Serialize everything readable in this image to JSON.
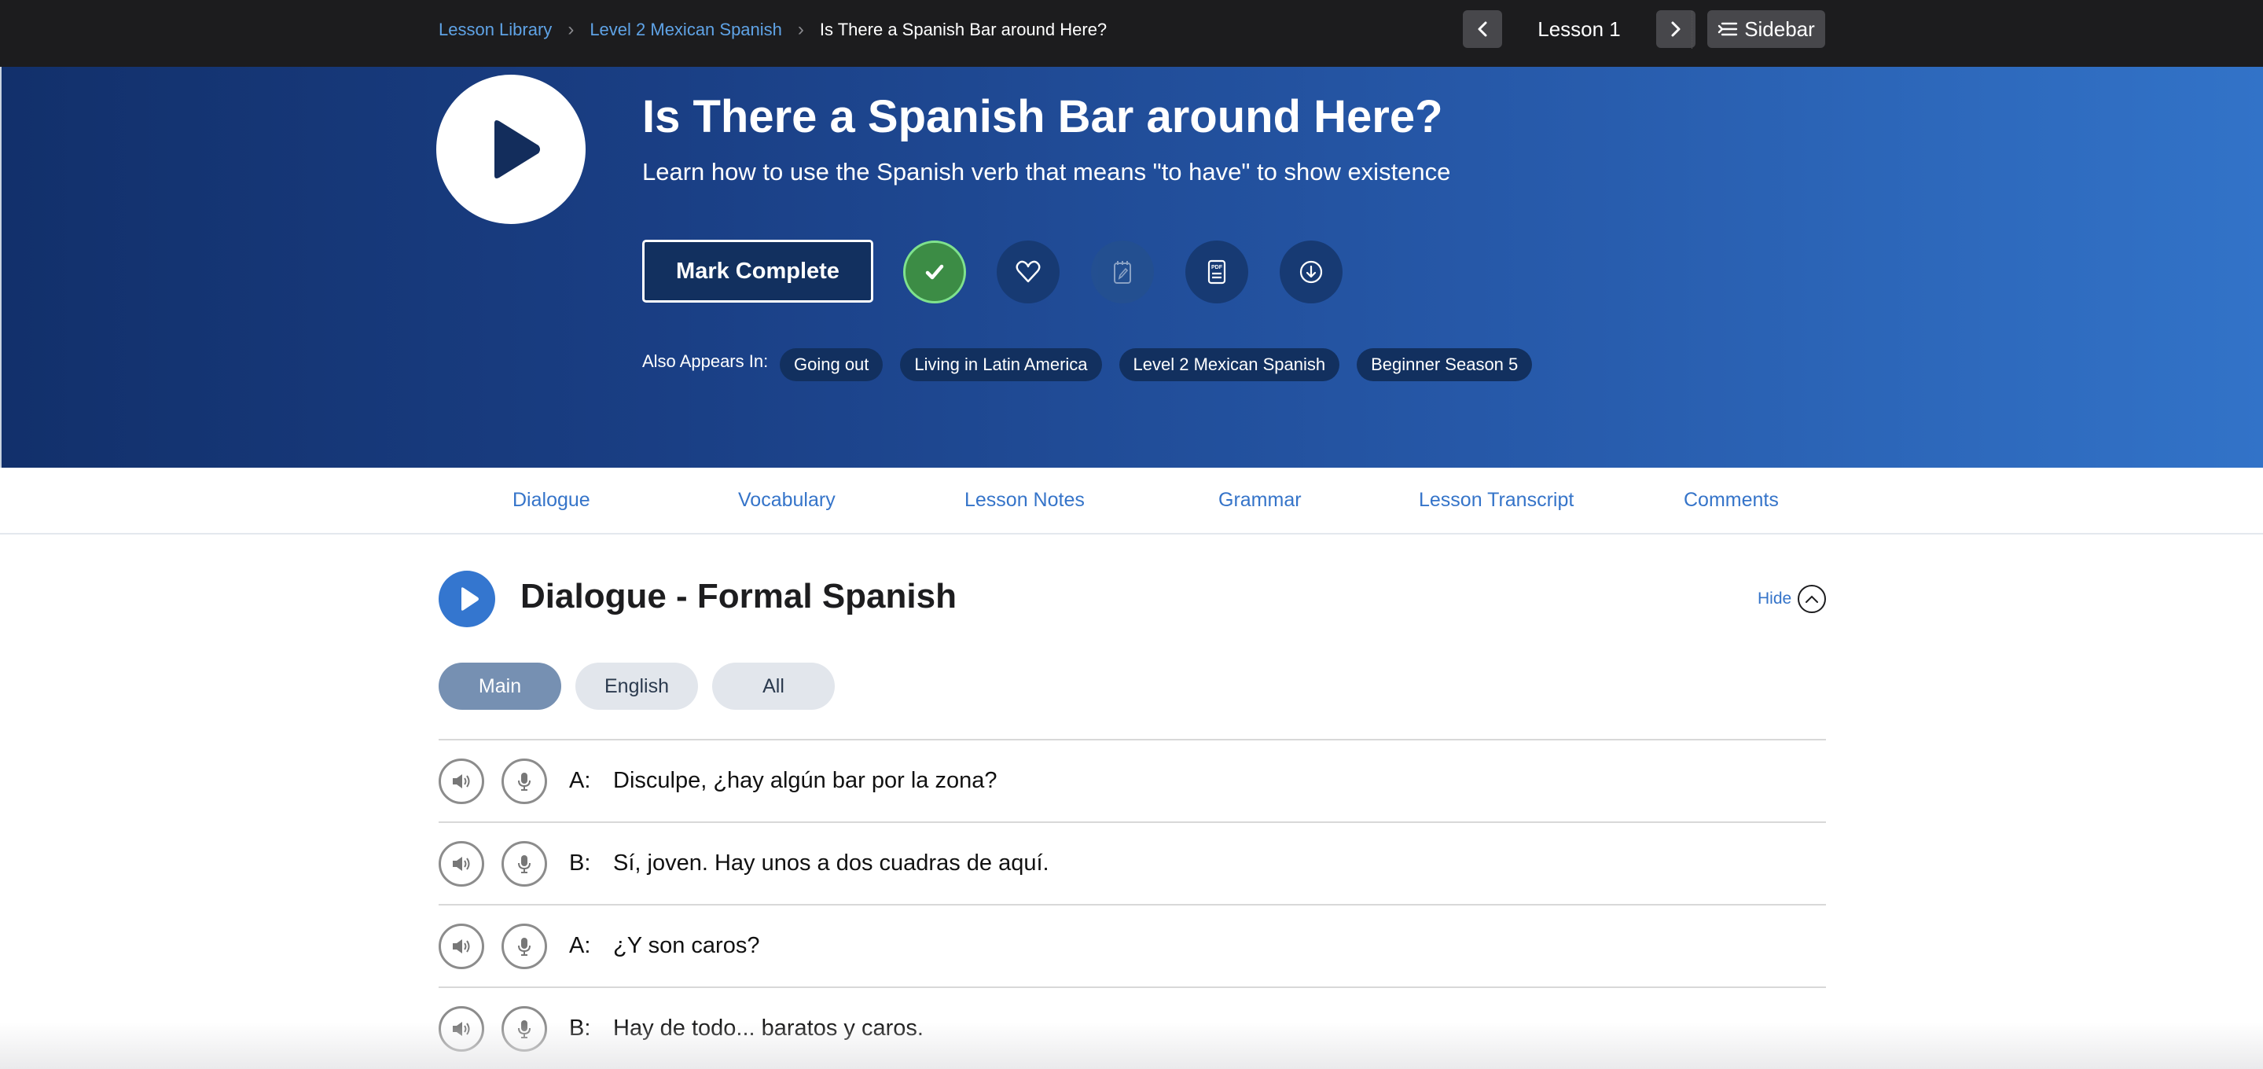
{
  "breadcrumb": {
    "items": [
      "Lesson Library",
      "Level 2 Mexican Spanish"
    ],
    "current": "Is There a Spanish Bar around Here?"
  },
  "lesson_nav": {
    "label": "Lesson 1",
    "sidebar_label": "Sidebar"
  },
  "hero": {
    "title": "Is There a Spanish Bar around Here?",
    "subtitle": "Learn how to use the Spanish verb that means \"to have\" to show existence",
    "mark_complete_label": "Mark Complete",
    "actions": [
      {
        "icon": "check-icon",
        "state": "complete"
      },
      {
        "icon": "heart-icon",
        "state": "default"
      },
      {
        "icon": "notepad-icon",
        "state": "disabled"
      },
      {
        "icon": "pdf-icon",
        "state": "default"
      },
      {
        "icon": "download-icon",
        "state": "default"
      }
    ],
    "also_appears_label": "Also Appears In:",
    "also_appears": [
      "Going out",
      "Living in Latin America",
      "Level 2 Mexican Spanish",
      "Beginner Season 5"
    ]
  },
  "tabs": [
    "Dialogue",
    "Vocabulary",
    "Lesson Notes",
    "Grammar",
    "Lesson Transcript",
    "Comments"
  ],
  "dialogue": {
    "title": "Dialogue - Formal Spanish",
    "hide_label": "Hide",
    "filters": [
      {
        "label": "Main",
        "active": true
      },
      {
        "label": "English",
        "active": false
      },
      {
        "label": "All",
        "active": false
      }
    ],
    "lines": [
      {
        "speaker": "A:",
        "text": "Disculpe, ¿hay algún bar por la zona?"
      },
      {
        "speaker": "B:",
        "text": "Sí, joven. Hay unos a dos cuadras de aquí."
      },
      {
        "speaker": "A:",
        "text": "¿Y son caros?"
      },
      {
        "speaker": "B:",
        "text": "Hay de todo... baratos y caros."
      }
    ]
  },
  "colors": {
    "topbar": "#1c1c1e",
    "link": "#5fa3e6",
    "accent": "#3574c9",
    "hero_start": "#12306b",
    "hero_end": "#3273c8",
    "complete_green": "#3c8c45"
  }
}
